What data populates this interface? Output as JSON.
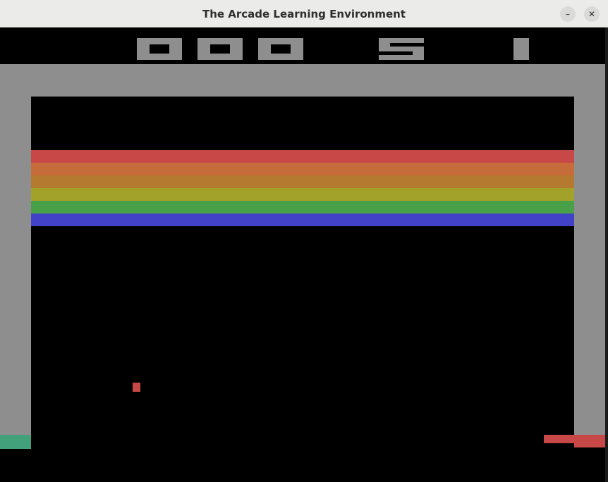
{
  "window": {
    "title": "The Arcade Learning Environment",
    "minimize_symbol": "–",
    "close_symbol": "✕"
  },
  "game": {
    "name": "Breakout",
    "score": "000",
    "lives": "5",
    "player": "1",
    "brick_row_colors": [
      "#c84848",
      "#c66c3a",
      "#b47a30",
      "#a2a22a",
      "#48a048",
      "#4242c8"
    ],
    "wall_color": "#8e8e8e",
    "ball_color": "#c84848",
    "paddle_color": "#c84848",
    "left_wall_base_color": "#42a07a"
  }
}
